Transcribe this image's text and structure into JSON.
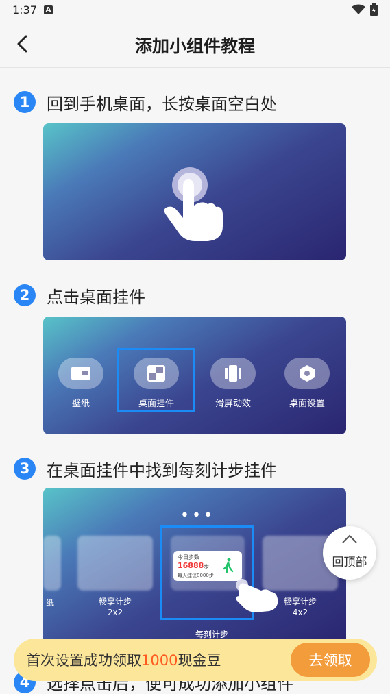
{
  "status": {
    "time": "1:37",
    "notif_badge": "A"
  },
  "header": {
    "title": "添加小组件教程"
  },
  "steps": [
    {
      "num": "1",
      "text": "回到手机桌面，长按桌面空白处"
    },
    {
      "num": "2",
      "text": "点击桌面挂件"
    },
    {
      "num": "3",
      "text": "在桌面挂件中找到每刻计步挂件"
    },
    {
      "num": "4",
      "text": "选择点击后，便可成功添加小组件"
    }
  ],
  "step2_menu": [
    "壁纸",
    "桌面挂件",
    "滑屏动效",
    "桌面设置"
  ],
  "step3_widgets": {
    "left_label": "纸",
    "widget2": "畅享计步\n2x2",
    "widget3": "每刻计步",
    "widget4": "畅享计步\n4x2",
    "mini_title": "今日步数",
    "mini_steps": "16888",
    "mini_unit": "步",
    "mini_note": "每天建议8000步"
  },
  "back_to_top": {
    "label": "回顶部"
  },
  "banner": {
    "text_pre": "首次设置成功领取",
    "text_highlight": "1000",
    "text_post": "现金豆",
    "button": "去领取"
  },
  "colors": {
    "accent": "#2b86f5",
    "banner_bg": "#fbe69a",
    "banner_btn": "#f39c3c",
    "highlight": "#ff5a1f"
  }
}
